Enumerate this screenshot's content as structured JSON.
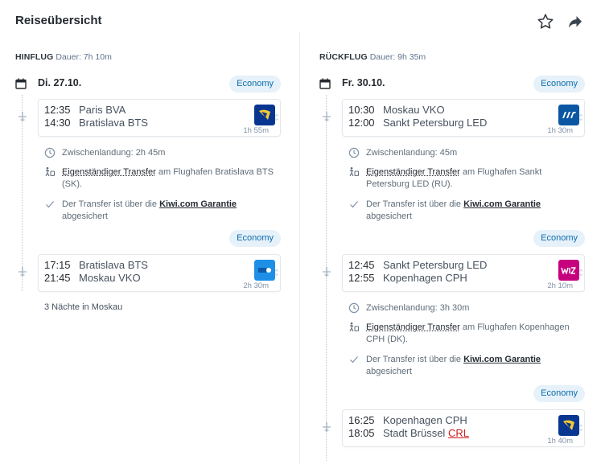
{
  "header": {
    "title": "Reiseübersicht",
    "star_icon": "star-icon",
    "share_icon": "share-icon"
  },
  "outbound": {
    "label": "HINFLUG",
    "duration": "Dauer: 7h 10m",
    "date": "Di. 27.10.",
    "class_badge": "Economy",
    "segments": [
      {
        "dep_time": "12:35",
        "dep_place": "Paris BVA",
        "arr_time": "14:30",
        "arr_place": "Bratislava BTS",
        "duration": "1h 55m",
        "airline_logo": "ryanair-logo"
      },
      {
        "dep_time": "17:15",
        "dep_place": "Bratislava BTS",
        "arr_time": "21:45",
        "arr_place": "Moskau VKO",
        "duration": "2h 30m",
        "airline_logo": "airline-logo-blue"
      }
    ],
    "layover": {
      "stop": "Zwischenlandung: 2h 45m",
      "transfer_link": "Eigenständiger Transfer",
      "transfer_rest": " am Flughafen Bratislava BTS (SK).",
      "guarantee_pre": "Der Transfer ist über die ",
      "guarantee_link": "Kiwi.com Garantie",
      "guarantee_post": " abgesichert",
      "class_badge": "Economy"
    },
    "nights": "3 Nächte in Moskau"
  },
  "inbound": {
    "label": "RÜCKFLUG",
    "duration": "Dauer: 9h 35m",
    "date": "Fr. 30.10.",
    "class_badge": "Economy",
    "segments": [
      {
        "dep_time": "10:30",
        "dep_place": "Moskau VKO",
        "arr_time": "12:00",
        "arr_place": "Sankt Petersburg LED",
        "duration": "1h 30m",
        "airline_logo": "utair-logo"
      },
      {
        "dep_time": "12:45",
        "dep_place": "Sankt Petersburg LED",
        "arr_time": "12:55",
        "arr_place": "Kopenhagen CPH",
        "duration": "2h 10m",
        "airline_logo": "wizz-logo"
      },
      {
        "dep_time": "16:25",
        "dep_place": "Kopenhagen CPH",
        "arr_time": "18:05",
        "arr_place": "Stadt Brüssel",
        "arr_code": "CRL",
        "duration": "1h 40m",
        "airline_logo": "ryanair-logo"
      }
    ],
    "layovers": [
      {
        "stop": "Zwischenlandung: 45m",
        "transfer_link": "Eigenständiger Transfer",
        "transfer_rest": " am Flughafen Sankt Petersburg LED (RU).",
        "guarantee_pre": "Der Transfer ist über die ",
        "guarantee_link": "Kiwi.com Garantie",
        "guarantee_post": " abgesichert",
        "class_badge": "Economy"
      },
      {
        "stop": "Zwischenlandung: 3h 30m",
        "transfer_link": "Eigenständiger Transfer",
        "transfer_rest": " am Flughafen Kopenhagen CPH (DK).",
        "guarantee_pre": "Der Transfer ist über die ",
        "guarantee_link": "Kiwi.com Garantie",
        "guarantee_post": " abgesichert",
        "class_badge": "Economy"
      }
    ]
  },
  "colors": {
    "accent": "#0d6ead",
    "badge_bg": "#e6f1fa",
    "ryanair": "#073590",
    "ryanair_harp": "#f1c933",
    "utair": "#0a56a3",
    "wizz": "#c6007e",
    "blue_logo": "#1e8fe6",
    "crl": "#d21c1c"
  }
}
